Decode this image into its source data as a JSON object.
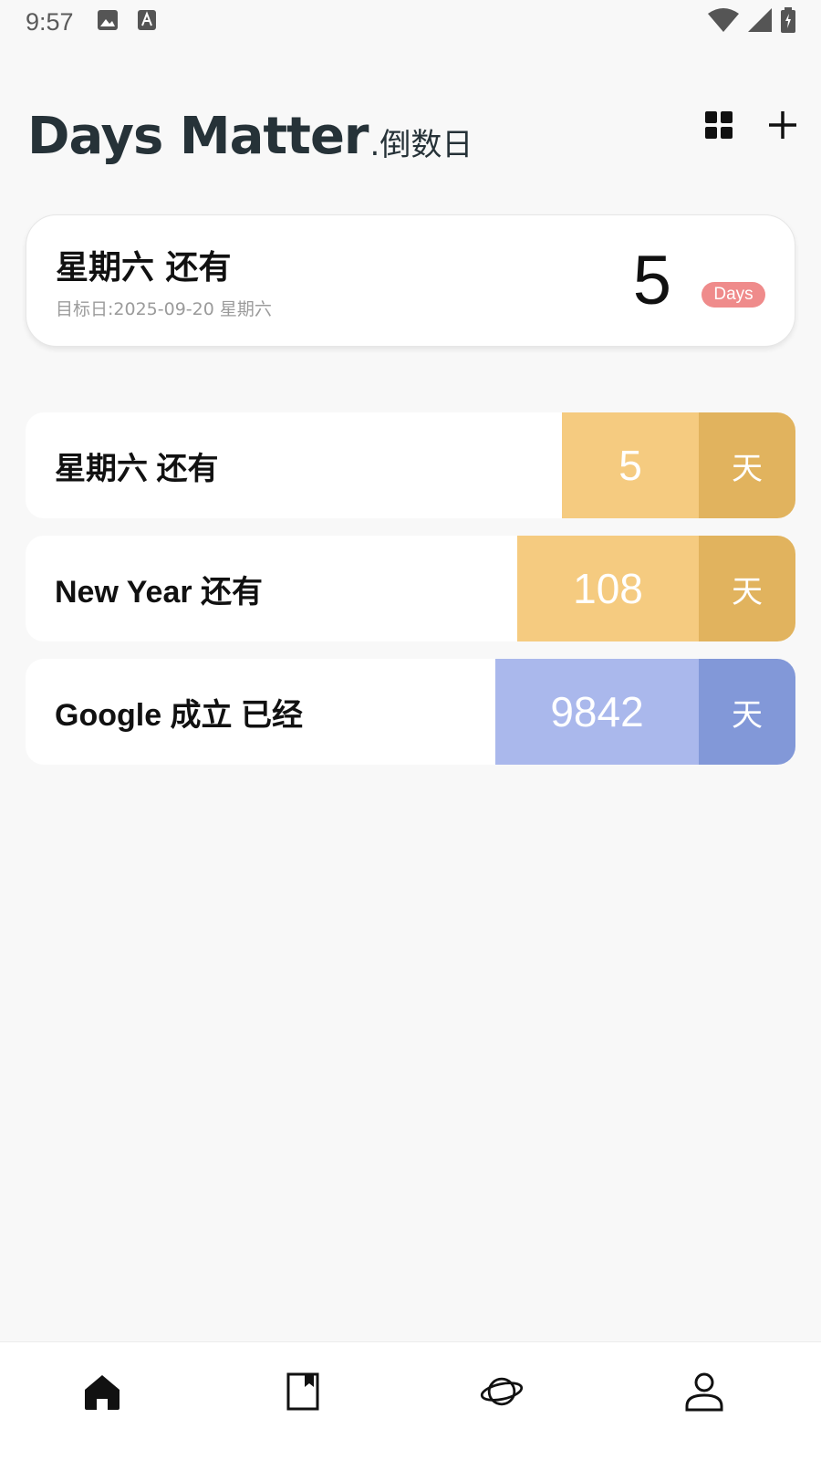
{
  "status_bar": {
    "time": "9:57",
    "left_icons": [
      "image-icon",
      "text-a-icon"
    ],
    "right_icons": [
      "wifi-icon",
      "signal-icon",
      "battery-icon"
    ]
  },
  "header": {
    "title": "Days Matter",
    "subtitle": ".倒数日",
    "actions": [
      "grid-icon",
      "plus-icon"
    ]
  },
  "featured": {
    "title": "星期六 还有",
    "date": "目标日:2025-09-20 星期六",
    "count": "5",
    "badge": "Days",
    "badge_color": "#ef8b8b"
  },
  "events": [
    {
      "title": "星期六 还有",
      "count": "5",
      "unit": "天",
      "count_color": "#f5cb80",
      "unit_color": "#e1b35e"
    },
    {
      "title": "New Year 还有",
      "count": "108",
      "unit": "天",
      "count_color": "#f5cb80",
      "unit_color": "#e1b35e"
    },
    {
      "title": "Google 成立 已经",
      "count": "9842",
      "unit": "天",
      "count_color": "#aab8ec",
      "unit_color": "#8298d8"
    }
  ],
  "bottom_nav": {
    "items": [
      "home-icon",
      "bookmark-icon",
      "planet-icon",
      "profile-icon"
    ],
    "active": "home-icon"
  }
}
